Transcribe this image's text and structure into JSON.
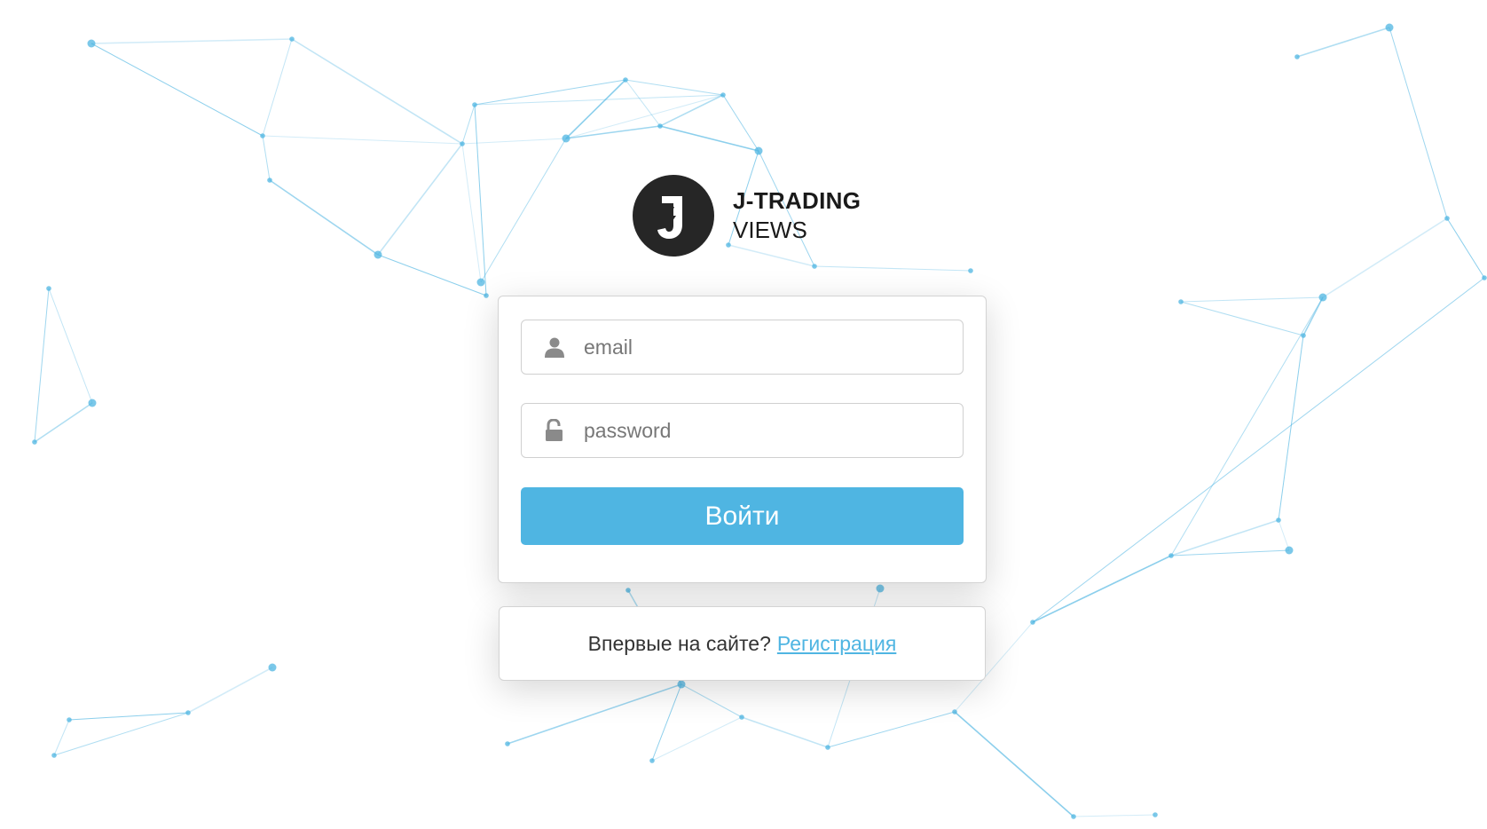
{
  "logo": {
    "title": "J-TRADING",
    "subtitle": "VIEWS",
    "icon": "j-lightning-logo-icon",
    "circle_color": "#262626"
  },
  "login_form": {
    "email_placeholder": "email",
    "email_icon": "user-icon",
    "password_placeholder": "password",
    "password_icon": "unlock-icon",
    "submit_label": "Войти",
    "button_color": "#4fb5e2"
  },
  "signup": {
    "prompt": "Впервые на сайте?",
    "link_label": "Регистрация",
    "link_color": "#4fb5e2"
  },
  "background": {
    "style": "network-lines",
    "line_color": "#4fb5e2"
  }
}
